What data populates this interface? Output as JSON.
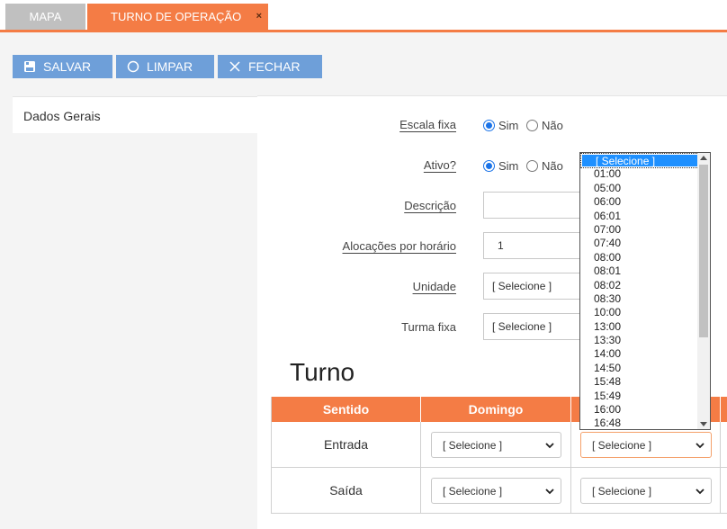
{
  "tabs": [
    {
      "label": "MAPA"
    },
    {
      "label": "TURNO DE OPERAÇÃO",
      "close": "×"
    }
  ],
  "toolbar": {
    "save_label": "SALVAR",
    "clear_label": "LIMPAR",
    "close_label": "FECHAR"
  },
  "nav": {
    "item": "Dados Gerais"
  },
  "form": {
    "escala_fixa": {
      "label": "Escala fixa",
      "yes": "Sim",
      "no": "Não",
      "value": "Sim"
    },
    "ativo": {
      "label": "Ativo?",
      "yes": "Sim",
      "no": "Não",
      "value": "Sim"
    },
    "descricao": {
      "label": "Descrição",
      "value": ""
    },
    "alocacoes": {
      "label": "Alocações por horário",
      "value": "1"
    },
    "unidade": {
      "label": "Unidade",
      "value": "[ Selecione ]"
    },
    "turma_fixa": {
      "label": "Turma fixa",
      "value": "[ Selecione ]"
    }
  },
  "turno": {
    "title": "Turno",
    "headers": [
      "Sentido",
      "Domingo"
    ],
    "rows": [
      {
        "label": "Entrada",
        "domingo": "[ Selecione ]",
        "next": "[ Selecione ]"
      },
      {
        "label": "Saída",
        "domingo": "[ Selecione ]",
        "next": "[ Selecione ]"
      }
    ]
  },
  "dropdown": {
    "selected": "[ Selecione ]",
    "options": [
      "[ Selecione ]",
      "01:00",
      "05:00",
      "06:00",
      "06:01",
      "07:00",
      "07:40",
      "08:00",
      "08:01",
      "08:02",
      "08:30",
      "10:00",
      "13:00",
      "13:30",
      "14:00",
      "14:50",
      "15:48",
      "15:49",
      "16:00",
      "16:48"
    ]
  },
  "colors": {
    "accent": "#f47c45",
    "button": "#6e9fd9",
    "selection": "#1e90ff"
  }
}
